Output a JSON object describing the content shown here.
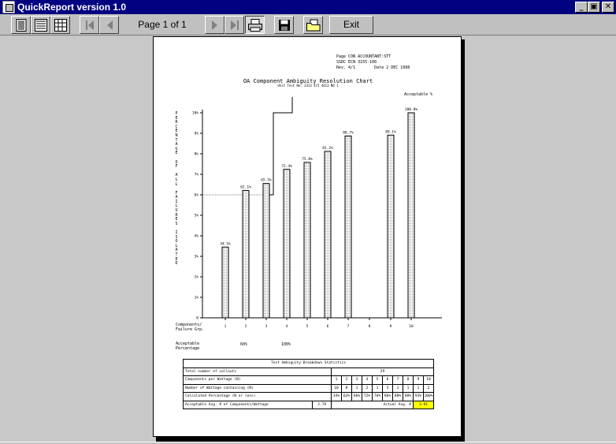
{
  "window": {
    "title": "QuickReport version 1.0",
    "min_glyph": "_",
    "max_glyph": "▣",
    "close_glyph": "✕"
  },
  "toolbar": {
    "page_indicator": "Page 1 of 1",
    "exit_label": "Exit"
  },
  "report": {
    "header_lines": [
      "Page CON ACCOUNTANT:STT",
      "SSDC ECN 3155-100",
      "Rev. 4/1        Date 2 DEC 1998"
    ],
    "title": "OA Component Ambiguity Resolution Chart",
    "subtitle": "Unit Test No. 3313 4/5 4413 NO 1",
    "acceptable_label": "Acceptable %",
    "y_axis_label": "PERCENTAGE OF ALL FAILURES ISOLATED",
    "components_label": [
      "Components/",
      "Failure Grp."
    ],
    "acceptable_pct_label": [
      "Acceptable",
      "Percentage"
    ],
    "acceptable_values": [
      "60%",
      "100%"
    ]
  },
  "chart_data": {
    "type": "bar",
    "categories": [
      "1",
      "2",
      "3",
      "4",
      "5",
      "6",
      "7",
      "8",
      "9",
      "10"
    ],
    "values": [
      34.5,
      62.1,
      65.5,
      72.4,
      75.8,
      81.2,
      88.7,
      null,
      89.1,
      100
    ],
    "data_labels": [
      "34.5%",
      "62.1%",
      "65.5%",
      "72.4%",
      "75.8%",
      "81.2%",
      "88.7%",
      "",
      "89.1%",
      "100.0%"
    ],
    "yticks": [
      "0",
      "1%",
      "2%",
      "3%",
      "4%",
      "5%",
      "6%",
      "7%",
      "8%",
      "9%",
      "10%"
    ],
    "ylim": [
      0,
      100
    ],
    "acceptable_level": 60,
    "xlabel": "Components/ Failure Grp.",
    "ylabel": "PERCENTAGE OF ALL FAILURES ISOLATED",
    "grid": false
  },
  "stats": {
    "title": "Test Ambiguity Breakdown Statistics",
    "total_label": "Total number of callouts",
    "total_value": "29",
    "components_label": "Components per Wattage (N)",
    "components": [
      "1",
      "2",
      "3",
      "4",
      "5",
      "6",
      "7",
      "8",
      "9",
      "10"
    ],
    "wattage_label": "Number of Wattage containing (N)",
    "wattage": [
      "10",
      "8",
      "1",
      "2",
      "1",
      "5",
      "1",
      "1",
      "1",
      "2"
    ],
    "calc_label": "Calculated Percentage (N or less)",
    "calc": [
      "34%",
      "62%",
      "66%",
      "72%",
      "76%",
      "86%",
      "88%",
      "88%",
      "93%",
      "100%"
    ],
    "avg_label": "Acceptable Avg. # of Components/Wattage",
    "avg_value": "2.79",
    "actual_label": "Actual Avg. #",
    "actual_value": "3.91"
  }
}
